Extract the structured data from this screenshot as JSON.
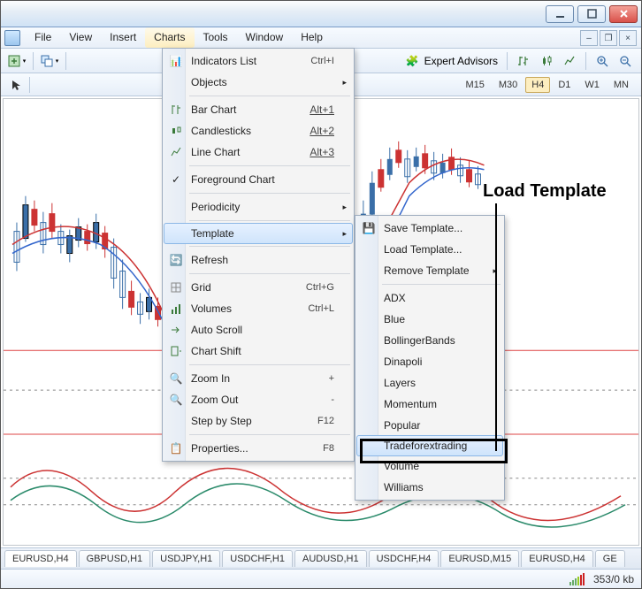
{
  "menubar": {
    "file": "File",
    "view": "View",
    "insert": "Insert",
    "charts": "Charts",
    "tools": "Tools",
    "window": "Window",
    "help": "Help"
  },
  "toolbar": {
    "expert_advisors": "Expert Advisors"
  },
  "timeframes": {
    "m15": "M15",
    "m30": "M30",
    "h4": "H4",
    "d1": "D1",
    "w1": "W1",
    "mn": "MN"
  },
  "charts_menu": {
    "indicators": "Indicators List",
    "indicators_sc": "Ctrl+I",
    "objects": "Objects",
    "bar": "Bar Chart",
    "bar_sc": "Alt+1",
    "candle": "Candlesticks",
    "candle_sc": "Alt+2",
    "line": "Line Chart",
    "line_sc": "Alt+3",
    "foreground": "Foreground Chart",
    "periodicity": "Periodicity",
    "template": "Template",
    "refresh": "Refresh",
    "grid": "Grid",
    "grid_sc": "Ctrl+G",
    "volumes": "Volumes",
    "volumes_sc": "Ctrl+L",
    "autoscroll": "Auto Scroll",
    "chartshift": "Chart Shift",
    "zoomin": "Zoom In",
    "zoomin_sc": "+",
    "zoomout": "Zoom Out",
    "zoomout_sc": "-",
    "step": "Step by Step",
    "step_sc": "F12",
    "properties": "Properties...",
    "properties_sc": "F8"
  },
  "template_submenu": {
    "save": "Save Template...",
    "load": "Load Template...",
    "remove": "Remove Template",
    "adx": "ADX",
    "blue": "Blue",
    "bollinger": "BollingerBands",
    "dinapoli": "Dinapoli",
    "layers": "Layers",
    "momentum": "Momentum",
    "popular": "Popular",
    "tradeforex": "Tradeforextrading",
    "volume": "Volume",
    "williams": "Williams"
  },
  "tabs": {
    "t1": "EURUSD,H4",
    "t2": "GBPUSD,H1",
    "t3": "USDJPY,H1",
    "t4": "USDCHF,H1",
    "t5": "AUDUSD,H1",
    "t6": "USDCHF,H4",
    "t7": "EURUSD,M15",
    "t8": "EURUSD,H4",
    "t9": "GE"
  },
  "status": {
    "kb": "353/0 kb"
  },
  "annotation": {
    "load_template": "Load Template"
  }
}
